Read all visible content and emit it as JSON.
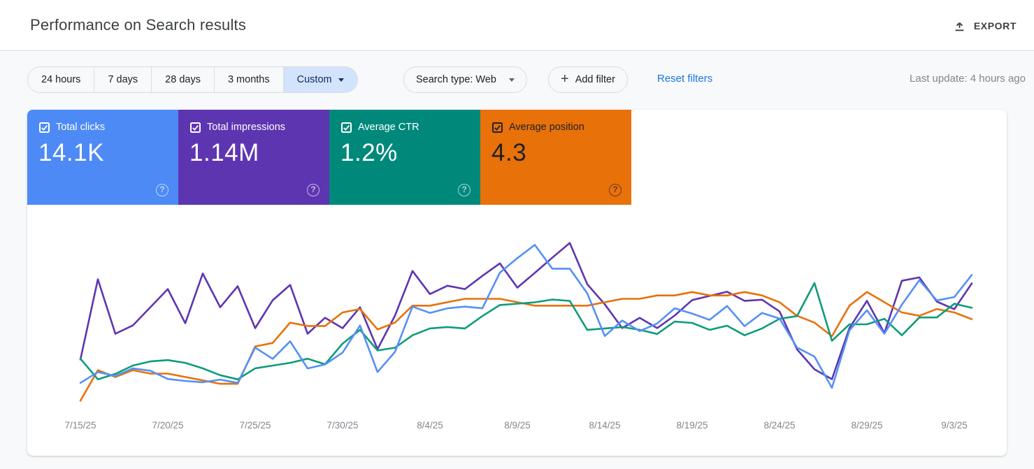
{
  "header": {
    "title": "Performance on Search results",
    "export_label": "EXPORT"
  },
  "filters": {
    "date_ranges": [
      "24 hours",
      "7 days",
      "28 days",
      "3 months",
      "Custom"
    ],
    "selected_date_range": "Custom",
    "search_type_label": "Search type: Web",
    "add_filter_label": "Add filter",
    "reset_filters_label": "Reset filters",
    "last_update": "Last update: 4 hours ago"
  },
  "icons": {
    "plus": "+",
    "help": "?"
  },
  "metric_cards": [
    {
      "id": "clicks",
      "label": "Total clicks",
      "value": "14.1K",
      "color": "#4d8af6",
      "text_color": "#ffffff",
      "checked": true
    },
    {
      "id": "impressions",
      "label": "Total impressions",
      "value": "1.14M",
      "color": "#5e35b1",
      "text_color": "#ffffff",
      "checked": true
    },
    {
      "id": "ctr",
      "label": "Average CTR",
      "value": "1.2%",
      "color": "#00897b",
      "text_color": "#ffffff",
      "checked": true
    },
    {
      "id": "position",
      "label": "Average position",
      "value": "4.3",
      "color": "#e8710a",
      "text_color": "#202124",
      "checked": true
    }
  ],
  "chart_data": {
    "type": "line",
    "title": "",
    "xlabel": "",
    "ylabel": "",
    "grid": false,
    "legend_position": "none",
    "x": [
      "7/15/25",
      "7/16/25",
      "7/17/25",
      "7/18/25",
      "7/19/25",
      "7/20/25",
      "7/21/25",
      "7/22/25",
      "7/23/25",
      "7/24/25",
      "7/25/25",
      "7/26/25",
      "7/27/25",
      "7/28/25",
      "7/29/25",
      "7/30/25",
      "7/31/25",
      "8/1/25",
      "8/2/25",
      "8/3/25",
      "8/4/25",
      "8/5/25",
      "8/6/25",
      "8/7/25",
      "8/8/25",
      "8/9/25",
      "8/10/25",
      "8/11/25",
      "8/12/25",
      "8/13/25",
      "8/14/25",
      "8/15/25",
      "8/16/25",
      "8/17/25",
      "8/18/25",
      "8/19/25",
      "8/20/25",
      "8/21/25",
      "8/22/25",
      "8/23/25",
      "8/24/25",
      "8/25/25",
      "8/26/25",
      "8/27/25",
      "8/28/25",
      "8/29/25",
      "8/30/25",
      "8/31/25",
      "9/1/25",
      "9/2/25",
      "9/3/25",
      "9/4/25"
    ],
    "x_tick_labels": [
      "7/15/25",
      "7/20/25",
      "7/25/25",
      "7/30/25",
      "8/4/25",
      "8/9/25",
      "8/14/25",
      "8/19/25",
      "8/24/25",
      "8/29/25",
      "9/3/25"
    ],
    "series": [
      {
        "id": "impressions",
        "name": "Total impressions",
        "color": "#5e35b1",
        "axis_range": [
          7800,
          30700
        ],
        "inverted": false,
        "values": [
          14600,
          25200,
          18000,
          19100,
          21500,
          23900,
          19400,
          25950,
          21500,
          24280,
          18740,
          22430,
          24460,
          18000,
          20120,
          18740,
          21500,
          15970,
          20400,
          26300,
          23250,
          24350,
          23900,
          25650,
          27300,
          24100,
          26050,
          28050,
          30000,
          24550,
          21900,
          18750,
          20100,
          18750,
          20400,
          22450,
          23000,
          23550,
          22350,
          22500,
          20950,
          15950,
          13300,
          12000,
          18750,
          22350,
          18100,
          25000,
          25450,
          22250,
          21250,
          24650
        ]
      },
      {
        "id": "position",
        "name": "Average position",
        "color": "#e8710a",
        "axis_range": [
          2.0,
          7.1
        ],
        "inverted": true,
        "values": [
          6.8,
          5.9,
          6.1,
          5.9,
          6.0,
          6.0,
          6.1,
          6.2,
          6.3,
          6.3,
          5.2,
          5.1,
          4.5,
          4.6,
          4.6,
          4.2,
          4.1,
          4.7,
          4.5,
          4.0,
          4.0,
          3.9,
          3.8,
          3.8,
          3.8,
          3.9,
          4.0,
          4.0,
          4.0,
          4.0,
          3.9,
          3.8,
          3.8,
          3.7,
          3.7,
          3.6,
          3.7,
          3.7,
          3.6,
          3.7,
          3.9,
          4.3,
          4.5,
          4.9,
          4.0,
          3.6,
          3.9,
          4.2,
          4.3,
          4.1,
          4.2,
          4.4
        ]
      },
      {
        "id": "ctr",
        "name": "Average CTR",
        "color": "#0e9c7b",
        "axis_range": [
          0.59,
          1.85
        ],
        "inverted": false,
        "values": [
          0.97,
          0.82,
          0.86,
          0.92,
          0.95,
          0.96,
          0.94,
          0.9,
          0.85,
          0.82,
          0.9,
          0.92,
          0.94,
          0.97,
          0.93,
          1.08,
          1.18,
          1.03,
          1.05,
          1.14,
          1.19,
          1.2,
          1.19,
          1.28,
          1.36,
          1.37,
          1.38,
          1.4,
          1.39,
          1.18,
          1.19,
          1.2,
          1.18,
          1.15,
          1.24,
          1.23,
          1.18,
          1.21,
          1.14,
          1.19,
          1.26,
          1.28,
          1.52,
          1.1,
          1.22,
          1.22,
          1.26,
          1.14,
          1.27,
          1.27,
          1.37,
          1.34
        ]
      },
      {
        "id": "clicks",
        "name": "Total clicks",
        "color": "#5491f5",
        "axis_range": [
          25,
          550
        ],
        "inverted": false,
        "values": [
          110,
          143,
          131,
          154,
          147,
          122,
          116,
          112,
          120,
          110,
          217,
          183,
          236,
          154,
          166,
          202,
          284,
          143,
          204,
          341,
          322,
          336,
          341,
          336,
          444,
          488,
          528,
          456,
          456,
          381,
          252,
          299,
          267,
          290,
          336,
          320,
          301,
          343,
          282,
          322,
          305,
          217,
          190,
          95,
          269,
          330,
          259,
          347,
          421,
          360,
          370,
          437
        ]
      }
    ]
  }
}
